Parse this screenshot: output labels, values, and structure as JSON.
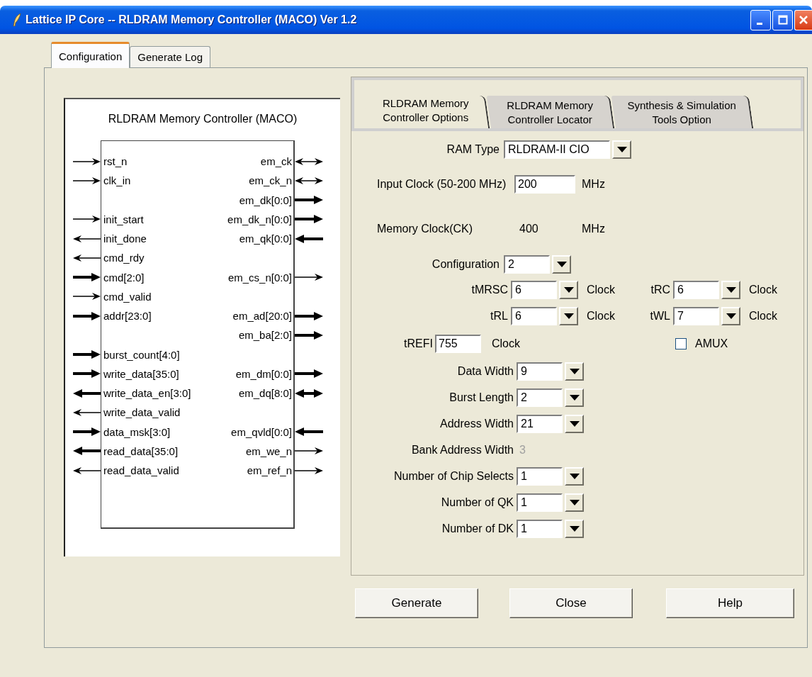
{
  "window": {
    "title": "Lattice IP Core -- RLDRAM Memory Controller (MACO) Ver 1.2"
  },
  "tabs": [
    {
      "label": "Configuration",
      "selected": true
    },
    {
      "label": "Generate Log",
      "selected": false
    }
  ],
  "diagram": {
    "title": "RLDRAM Memory Controller (MACO)",
    "rows": [
      {
        "left": {
          "label": "rst_n",
          "kind": "in",
          "bus": false
        },
        "right": {
          "label": "em_ck",
          "kind": "inout",
          "bus": false
        }
      },
      {
        "left": {
          "label": "clk_in",
          "kind": "in",
          "bus": false
        },
        "right": {
          "label": "em_ck_n",
          "kind": "inout",
          "bus": false
        }
      },
      {
        "right": {
          "label": "em_dk[0:0]",
          "kind": "out",
          "bus": true
        }
      },
      {
        "left": {
          "label": "init_start",
          "kind": "in",
          "bus": false
        },
        "right": {
          "label": "em_dk_n[0:0]",
          "kind": "out",
          "bus": true
        }
      },
      {
        "left": {
          "label": "init_done",
          "kind": "out",
          "bus": false
        },
        "right": {
          "label": "em_qk[0:0]",
          "kind": "in",
          "bus": true
        }
      },
      {
        "left": {
          "label": "cmd_rdy",
          "kind": "out",
          "bus": false
        }
      },
      {
        "left": {
          "label": "cmd[2:0]",
          "kind": "in",
          "bus": true
        },
        "right": {
          "label": "em_cs_n[0:0]",
          "kind": "out",
          "bus": false
        }
      },
      {
        "left": {
          "label": "cmd_valid",
          "kind": "in",
          "bus": false
        }
      },
      {
        "left": {
          "label": "addr[23:0]",
          "kind": "in",
          "bus": true
        },
        "right": {
          "label": "em_ad[20:0]",
          "kind": "out",
          "bus": true
        }
      },
      {
        "right": {
          "label": "em_ba[2:0]",
          "kind": "out",
          "bus": true
        }
      },
      {
        "left": {
          "label": "burst_count[4:0]",
          "kind": "in",
          "bus": true
        }
      },
      {
        "left": {
          "label": "write_data[35:0]",
          "kind": "in",
          "bus": true
        },
        "right": {
          "label": "em_dm[0:0]",
          "kind": "out",
          "bus": true
        }
      },
      {
        "left": {
          "label": "write_data_en[3:0]",
          "kind": "out",
          "bus": true
        },
        "right": {
          "label": "em_dq[8:0]",
          "kind": "inout",
          "bus": true
        }
      },
      {
        "left": {
          "label": "write_data_valid",
          "kind": "out",
          "bus": false
        }
      },
      {
        "left": {
          "label": "data_msk[3:0]",
          "kind": "in",
          "bus": true
        },
        "right": {
          "label": "em_qvld[0:0]",
          "kind": "in",
          "bus": true
        }
      },
      {
        "left": {
          "label": "read_data[35:0]",
          "kind": "out",
          "bus": true
        },
        "right": {
          "label": "em_we_n",
          "kind": "out",
          "bus": false
        }
      },
      {
        "left": {
          "label": "read_data_valid",
          "kind": "out",
          "bus": false
        },
        "right": {
          "label": "em_ref_n",
          "kind": "out",
          "bus": false
        }
      }
    ]
  },
  "option_tabs": [
    {
      "label": "RLDRAM Memory Controller Options",
      "selected": true
    },
    {
      "label": "RLDRAM Memory Controller Locator",
      "selected": false
    },
    {
      "label": "Synthesis & Simulation Tools Option",
      "selected": false
    }
  ],
  "options": {
    "ram_type": {
      "label": "RAM Type",
      "value": "RLDRAM-II CIO"
    },
    "input_clock": {
      "label": "Input Clock (50-200 MHz)",
      "value": "200",
      "unit": "MHz"
    },
    "memory_clock": {
      "label": "Memory Clock(CK)",
      "value": "400",
      "unit": "MHz"
    },
    "configuration": {
      "label": "Configuration",
      "value": "2"
    },
    "timing": [
      [
        {
          "label": "tMRSC",
          "value": "6",
          "unit": "Clock"
        },
        {
          "label": "tRC",
          "value": "6",
          "unit": "Clock"
        }
      ],
      [
        {
          "label": "tRL",
          "value": "6",
          "unit": "Clock"
        },
        {
          "label": "tWL",
          "value": "7",
          "unit": "Clock"
        }
      ]
    ],
    "trefi": {
      "label": "tREFI",
      "value": "755",
      "unit": "Clock"
    },
    "amux": {
      "label": "AMUX",
      "checked": false
    },
    "sizes": [
      {
        "kind": "combo",
        "label": "Data Width",
        "value": "9"
      },
      {
        "kind": "combo",
        "label": "Burst Length",
        "value": "2"
      },
      {
        "kind": "combo",
        "label": "Address Width",
        "value": "21"
      },
      {
        "kind": "info",
        "label": "Bank Address Width",
        "value": "3",
        "disabled": true
      },
      {
        "kind": "combo",
        "label": "Number of Chip Selects",
        "value": "1"
      },
      {
        "kind": "combo",
        "label": "Number of QK",
        "value": "1"
      },
      {
        "kind": "combo",
        "label": "Number of DK",
        "value": "1"
      }
    ]
  },
  "buttons": [
    "Generate",
    "Close",
    "Help"
  ]
}
